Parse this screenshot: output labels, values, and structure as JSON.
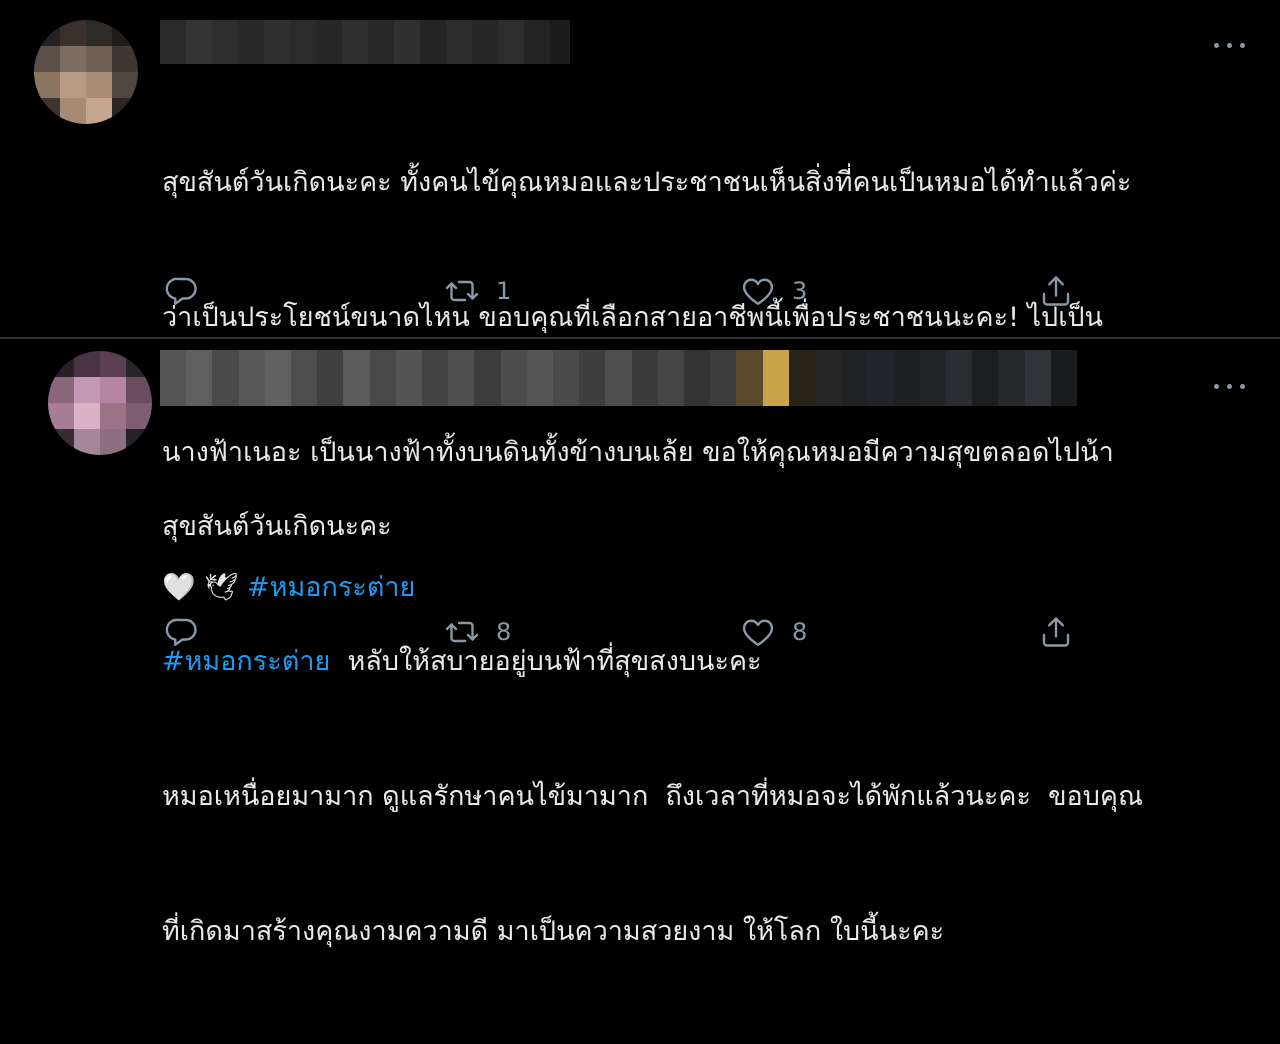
{
  "tweets": [
    {
      "lines": [
        "สุขสันต์วันเกิดนะคะ ทั้งคนไข้คุณหมอและประชาชนเห็นสิ่งที่คนเป็นหมอได้ทำแล้วค่ะ",
        "ว่าเป็นประโยชน์ขนาดไหน ขอบคุณที่เลือกสายอาชีพนี้เพื่อประชาชนนะคะ! ไปเป็น",
        "นางฟ้าเนอะ เป็นนางฟ้าทั้งบนดินทั้งข้างบนเล้ย ขอให้คุณหมอมีความสุขตลอดไปน้า"
      ],
      "emoji_line": "🤍 🕊 ",
      "hashtag": "#หมอกระต่าย",
      "reply_count": "",
      "retweet_count": "1",
      "like_count": "3"
    },
    {
      "line1": "สุขสันต์วันเกิดนะคะ",
      "hashtag": "#หมอกระต่าย",
      "line2_rest": "  หลับให้สบายอยู่บนฟ้าที่สุขสงบนะคะ",
      "line3": "หมอเหนื่อยมามาก ดูแลรักษาคนไข้มามาก  ถึงเวลาที่หมอจะได้พักแล้วนะคะ  ขอบคุณ",
      "line4": "ที่เกิดมาสร้างคุณงามความดี มาเป็นความสวยงาม ให้โลก ใบนี้นะคะ",
      "reply_count": "",
      "retweet_count": "8",
      "like_count": "8"
    }
  ],
  "icons": {
    "reply": "reply-icon",
    "retweet": "retweet-icon",
    "like": "heart-icon",
    "share": "share-icon",
    "more": "more-icon"
  },
  "colors": {
    "background": "#000000",
    "text": "#e7e9ea",
    "secondary": "#8b98a5",
    "hashtag": "#1d9bf0",
    "divider": "#2f3336"
  }
}
